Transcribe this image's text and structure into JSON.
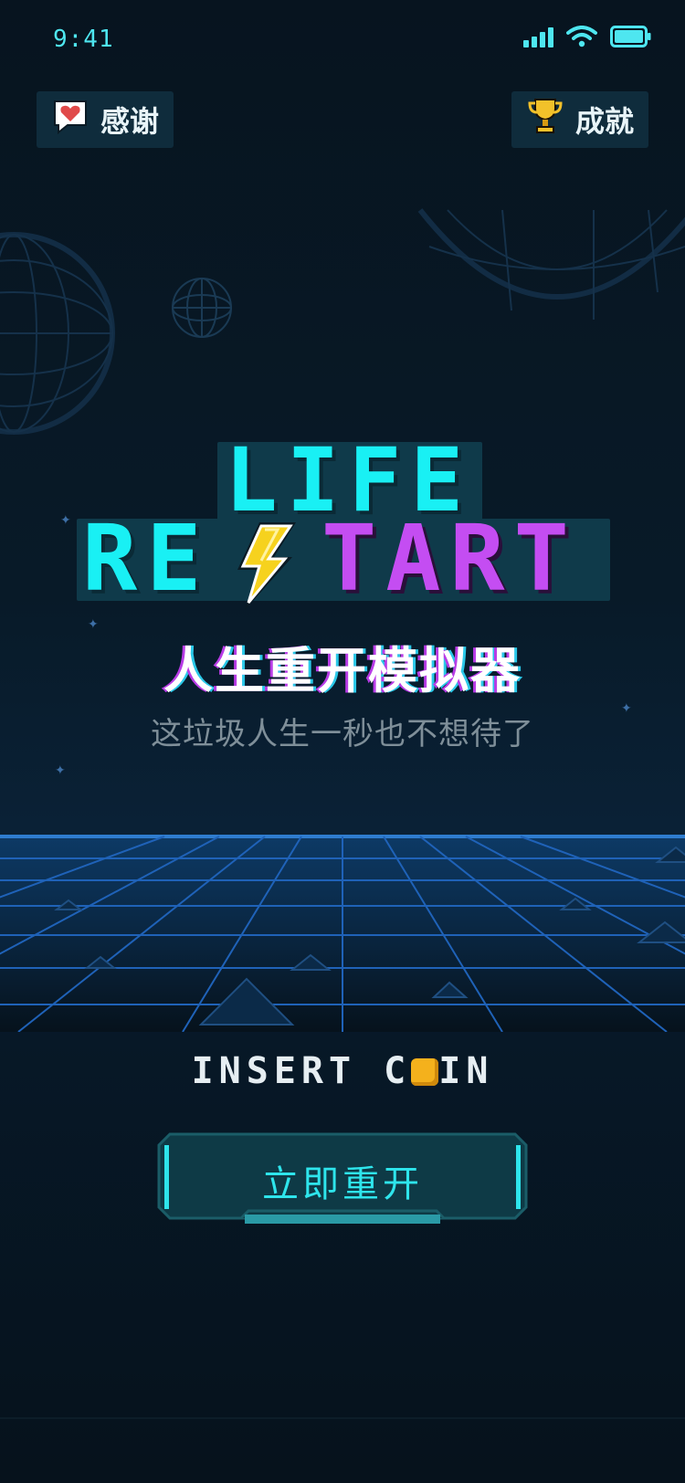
{
  "status": {
    "time": "9:41",
    "signal_icon": "signal-bars-icon",
    "wifi_icon": "wifi-icon",
    "battery_icon": "battery-icon"
  },
  "header": {
    "thanks": {
      "label": "感谢",
      "icon": "heart-speech-bubble-icon"
    },
    "achievements": {
      "label": "成就",
      "icon": "trophy-icon"
    }
  },
  "logo": {
    "line1": "LIFE",
    "line2_left": "RE",
    "line2_right": "TART",
    "bolt_icon": "lightning-bolt-icon"
  },
  "title": "人生重开模拟器",
  "tagline": "这垃圾人生一秒也不想待了",
  "insert_coin": {
    "before": "INSERT C",
    "after": "IN",
    "coin_icon": "coin-icon"
  },
  "start_button": {
    "label": "立即重开"
  },
  "colors": {
    "cyan": "#19f0f4",
    "purple": "#c44df2",
    "accent": "#2ee5ec",
    "coin": "#f4b11c",
    "bg": "#06121c"
  }
}
